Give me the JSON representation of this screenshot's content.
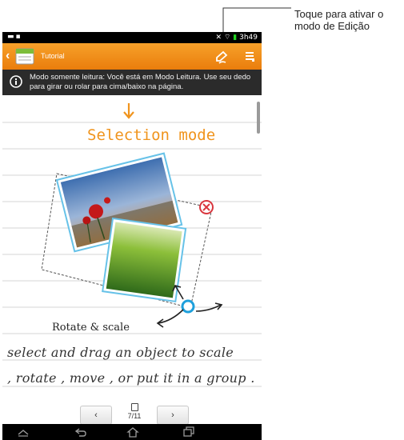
{
  "annotation": {
    "callout_line1": "Toque para ativar o",
    "callout_line2": "modo de Edição"
  },
  "statusbar": {
    "left_icons": [
      "notification-icon",
      "file-icon"
    ],
    "right_icons": [
      "mute-icon",
      "wifi-icon",
      "battery-icon"
    ],
    "time": "3h49"
  },
  "actionbar": {
    "title": "Tutorial",
    "accent_color": "#f08a17",
    "icons": [
      "back-chevron-icon",
      "notebook-app-icon",
      "edit-mode-icon",
      "menu-icon"
    ]
  },
  "info_banner": {
    "text": "Modo somente leitura: Você está em Modo Leitura. Use seu dedo para girar ou rolar para cima/baixo na página.",
    "icon": "info-icon"
  },
  "page_content": {
    "heading": "Selection mode",
    "caption": "Rotate & scale",
    "handwriting_line1": "select and drag an object to scale",
    "handwriting_line2": ", rotate , move , or put it in a group ."
  },
  "pager": {
    "prev_label": "‹",
    "next_label": "›",
    "page_indicator": "7/11"
  },
  "navbar": {
    "icons": [
      "collapse-icon",
      "back-icon",
      "home-icon",
      "recent-apps-icon"
    ]
  }
}
